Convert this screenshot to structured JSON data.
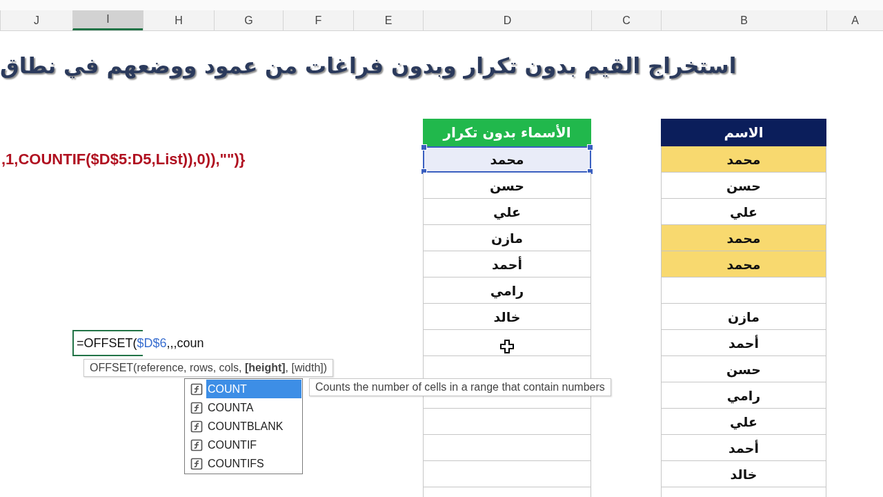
{
  "column_headers": [
    {
      "label": "A",
      "selected": false
    },
    {
      "label": "B",
      "selected": false
    },
    {
      "label": "C",
      "selected": false
    },
    {
      "label": "D",
      "selected": false
    },
    {
      "label": "E",
      "selected": false
    },
    {
      "label": "F",
      "selected": false
    },
    {
      "label": "G",
      "selected": false
    },
    {
      "label": "H",
      "selected": false
    },
    {
      "label": "I",
      "selected": true
    },
    {
      "label": "J",
      "selected": false
    }
  ],
  "title": "استخراج القيم بدون تكرار وبدون فراغات من عمود ووضعهم في نطاق",
  "formula_text": ",1,COUNTIF($D$5:D5,List)),0)),\"\")}",
  "unique_table": {
    "header": "الأسماء بدون تكرار",
    "rows": [
      {
        "value": "محمد",
        "selected": true
      },
      {
        "value": "حسن",
        "selected": false
      },
      {
        "value": "علي",
        "selected": false
      },
      {
        "value": "مازن",
        "selected": false
      },
      {
        "value": "أحمد",
        "selected": false
      },
      {
        "value": "رامي",
        "selected": false
      },
      {
        "value": "خالد",
        "selected": false
      }
    ]
  },
  "source_table": {
    "header": "الاسم",
    "rows": [
      {
        "kind": "name",
        "value": "محمد",
        "highlighted": true
      },
      {
        "kind": "name",
        "value": "حسن",
        "highlighted": false
      },
      {
        "kind": "name",
        "value": "علي",
        "highlighted": false
      },
      {
        "kind": "name",
        "value": "محمد",
        "highlighted": true
      },
      {
        "kind": "name",
        "value": "محمد",
        "highlighted": true
      },
      {
        "kind": "blank",
        "highlighted": false
      },
      {
        "kind": "name",
        "value": "مازن",
        "highlighted": false
      },
      {
        "kind": "name",
        "value": "أحمد",
        "highlighted": false
      },
      {
        "kind": "name",
        "value": "حسن",
        "highlighted": false
      },
      {
        "kind": "name",
        "value": "رامي",
        "highlighted": false
      },
      {
        "kind": "name",
        "value": "علي",
        "highlighted": false
      },
      {
        "kind": "name",
        "value": "أحمد",
        "highlighted": false
      },
      {
        "kind": "name",
        "value": "خالد",
        "highlighted": false
      }
    ]
  },
  "editing_cell": {
    "function_part": "=OFFSET(",
    "reference": "$D$6",
    "typed_rest": ",,,coun"
  },
  "signature_tooltip": "OFFSET(reference, rows, cols, **[height]**, [width])",
  "autocomplete": [
    {
      "label": "COUNT",
      "selected": true
    },
    {
      "label": "COUNTA",
      "selected": false
    },
    {
      "label": "COUNTBLANK",
      "selected": false
    },
    {
      "label": "COUNTIF",
      "selected": false
    },
    {
      "label": "COUNTIFS",
      "selected": false
    }
  ],
  "description_tooltip": "Counts the number of cells in a range that contain numbers"
}
